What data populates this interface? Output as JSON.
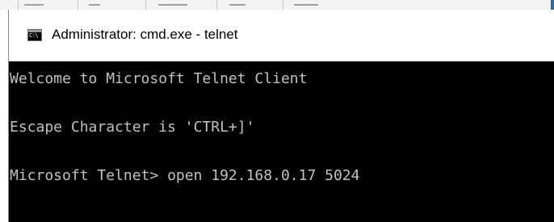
{
  "window": {
    "title": "Administrator: cmd.exe - telnet",
    "icon": "cmd-console-icon",
    "icon_text": "C:\\"
  },
  "console": {
    "lines": [
      "Welcome to Microsoft Telnet Client",
      "Escape Character is 'CTRL+]'",
      "Microsoft Telnet> open 192.168.0.17 5024"
    ],
    "text_color": "#c0c0c0",
    "background_color": "#000000"
  }
}
